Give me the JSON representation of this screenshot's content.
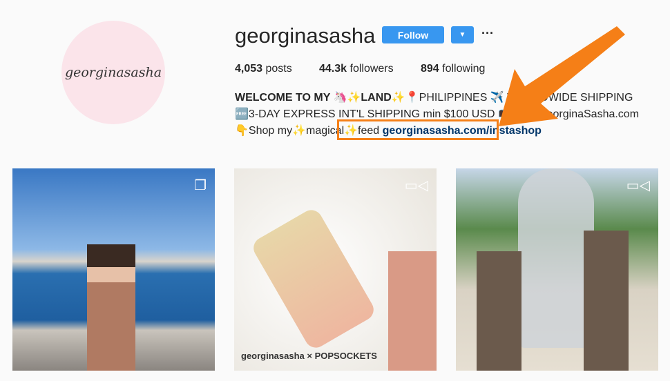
{
  "profile": {
    "username": "georginasasha",
    "avatar_text": "georginasasha",
    "follow_label": "Follow",
    "posts": "4,053",
    "posts_label": "posts",
    "followers": "44.3k",
    "followers_label": "followers",
    "following": "894",
    "following_label": "following"
  },
  "bio": {
    "line1_bold": "WELCOME TO MY 🦄✨LAND✨",
    "line1_rest": "📍PHILIPPINES ✈️ WORLDWIDE SHIPPING 🆓3-DAY EXPRESS INT'L SHIPPING min $100 USD 📭www.GeorginaSasha.com 👇Shop my✨magical✨feed ",
    "link": "georginasasha.com/instashop"
  },
  "posts": [
    {
      "type": "carousel",
      "icon": "carousel-icon"
    },
    {
      "type": "video",
      "icon": "video-icon",
      "caption": "georginasasha × POPSOCKETS"
    },
    {
      "type": "video",
      "icon": "video-icon"
    }
  ],
  "colors": {
    "accent": "#3897f0",
    "annotation": "#f57f17"
  }
}
